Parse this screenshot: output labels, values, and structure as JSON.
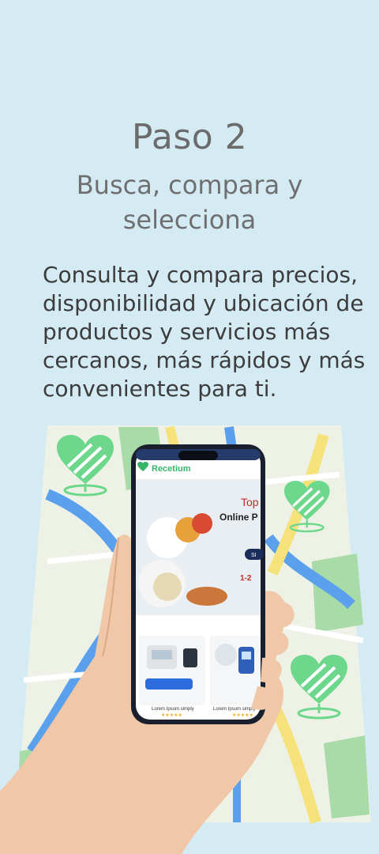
{
  "step": {
    "title": "Paso 2",
    "subtitle": "Busca, compara y selecciona",
    "body": "Consulta y compara precios, disponibilidad y ubicación de productos y servicios más cercanos, más rápidos y más convenientes para ti."
  },
  "phone_screen": {
    "brand": "Recetium",
    "hero_heading_1": "Top",
    "hero_heading_2": "Online P",
    "hero_phone_prefix": "1-2",
    "hero_button": "SI",
    "product_1_name": "Lorem Ipsum simply",
    "product_2_name": "Lorem Ipsum simply",
    "rating": "★★★★★"
  },
  "colors": {
    "background": "#d4ebf4",
    "map_base": "#eef2e6",
    "road_blue": "#5aa0ec",
    "road_yellow": "#f6e27a",
    "park_green": "#a8dba8",
    "heart_green": "#6dd88c",
    "brand_green": "#39b56a"
  },
  "icons": [
    "heart-location-pin-icon",
    "recetium-logo-icon"
  ]
}
